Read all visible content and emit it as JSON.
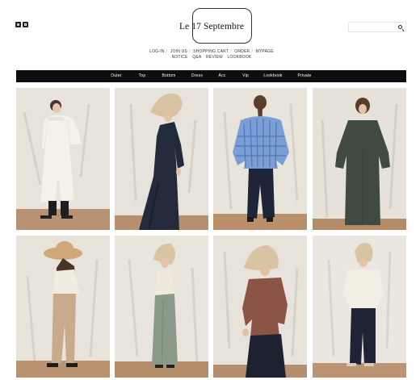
{
  "brand": {
    "name": "Le 17 Septembre",
    "social_icons": [
      "instagram-icon",
      "blog-icon"
    ]
  },
  "search": {
    "placeholder": "",
    "icon": "search-icon"
  },
  "utility_nav": {
    "row1": [
      "LOG-IN",
      "JOIN US",
      "SHOPPING CART",
      "ORDER",
      "MYPAGE"
    ],
    "row2": [
      "NOTICE",
      "Q&A",
      "REVIEW",
      "LOOKBOOK"
    ]
  },
  "main_nav": [
    "Outer",
    "Top",
    "Bottom",
    "Dress",
    "Acc",
    "Vip",
    "Lookbook",
    "Private"
  ],
  "colors": {
    "nav_background": "#0e0e0e",
    "backdrop": "#e8e4dc",
    "floor": "#b58e68"
  },
  "products": [
    {
      "outfit": "white long coat over black trousers",
      "hat": false
    },
    {
      "outfit": "navy long dress with beige wide-brim hat",
      "hat": true
    },
    {
      "outfit": "blue striped shirt with navy long skirt",
      "hat": false
    },
    {
      "outfit": "dark green long dress",
      "hat": false
    },
    {
      "outfit": "ivory top with beige wide trousers and straw hat",
      "hat": true
    },
    {
      "outfit": "ivory vest with sage green long skirt and hat",
      "hat": true
    },
    {
      "outfit": "brown top with navy skirt and beige hat",
      "hat": true
    },
    {
      "outfit": "ivory blouse with navy long skirt and hat",
      "hat": true
    }
  ]
}
